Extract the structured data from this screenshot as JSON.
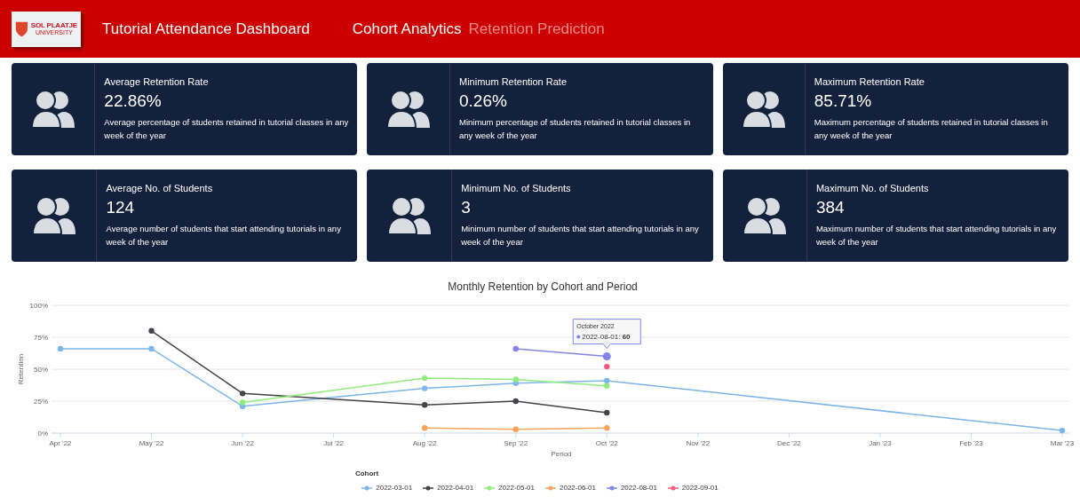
{
  "header": {
    "logo": {
      "line_1": "SOL PLAATJE",
      "line_2": "UNIVERSITY"
    },
    "title": "Tutorial Attendance Dashboard",
    "nav": [
      {
        "label": "Cohort Analytics",
        "selected": true
      },
      {
        "label": "Retention Prediction",
        "selected": false
      }
    ]
  },
  "cards": [
    {
      "title": "Average Retention Rate",
      "value": "22.86%",
      "description": "Average percentage of students retained in tutorial classes in any week of the year"
    },
    {
      "title": "Minimum Retention Rate",
      "value": "0.26%",
      "description": "Minimum percentage of students retained in tutorial classes in any week of the year"
    },
    {
      "title": "Maximum Retention Rate",
      "value": "85.71%",
      "description": "Maximum percentage of students retained in tutorial classes in any week of the year"
    },
    {
      "title": "Average No. of Students",
      "value": "124",
      "description": "Average number of students that start attending tutorials in any week of the year"
    },
    {
      "title": "Minimum No. of Students",
      "value": "3",
      "description": "Minimum number of students that start attending tutorials in any week of the year"
    },
    {
      "title": "Maximum No. of Students",
      "value": "384",
      "description": "Maximum number of students that start attending tutorials in any week of the year"
    }
  ],
  "chart": {
    "chart_data": {
      "type": "line",
      "title": "Monthly Retention by Cohort and Period",
      "xlabel": "Period",
      "ylabel": "Retention",
      "categories": [
        "Apr '22",
        "May '22",
        "Jun '22",
        "Jul '22",
        "Aug '22",
        "Sep '22",
        "Oct '22",
        "Nov '22",
        "Dec '22",
        "Jan '23",
        "Feb '23",
        "Mar '23"
      ],
      "ylim": [
        0,
        100
      ],
      "grid": true,
      "yticks": [
        {
          "value": 0,
          "label": "0%"
        },
        {
          "value": 25,
          "label": "25%"
        },
        {
          "value": 50,
          "label": "50%"
        },
        {
          "value": 75,
          "label": "75%"
        },
        {
          "value": 100,
          "label": "100%"
        }
      ],
      "series": [
        {
          "name": "2022-03-01",
          "color": "#7cb5ec",
          "marker": true,
          "values": [
            66,
            66,
            21,
            null,
            35,
            39,
            41,
            null,
            null,
            null,
            null,
            2
          ]
        },
        {
          "name": "2022-04-01",
          "color": "#434348",
          "marker": true,
          "values": [
            null,
            80,
            31,
            null,
            22,
            25,
            16,
            null,
            null,
            null,
            null,
            null
          ]
        },
        {
          "name": "2022-05-01",
          "color": "#90ed7d",
          "marker": true,
          "values": [
            null,
            null,
            24,
            null,
            43,
            42,
            37,
            null,
            null,
            null,
            null,
            null
          ]
        },
        {
          "name": "2022-06-01",
          "color": "#f7a35c",
          "marker": true,
          "values": [
            null,
            null,
            null,
            null,
            4,
            3,
            4,
            null,
            null,
            null,
            null,
            null
          ]
        },
        {
          "name": "2022-08-01",
          "color": "#8085e9",
          "marker": true,
          "values": [
            null,
            null,
            null,
            null,
            null,
            66,
            60,
            null,
            null,
            null,
            null,
            null
          ]
        },
        {
          "name": "2022-09-01",
          "color": "#f15c80",
          "marker": true,
          "values": [
            null,
            null,
            null,
            null,
            null,
            null,
            52,
            null,
            null,
            null,
            null,
            null
          ]
        }
      ]
    },
    "legend_title": "Cohort",
    "tooltip": {
      "heading": "October 2022",
      "text": "2022-08-01: **60**"
    }
  }
}
